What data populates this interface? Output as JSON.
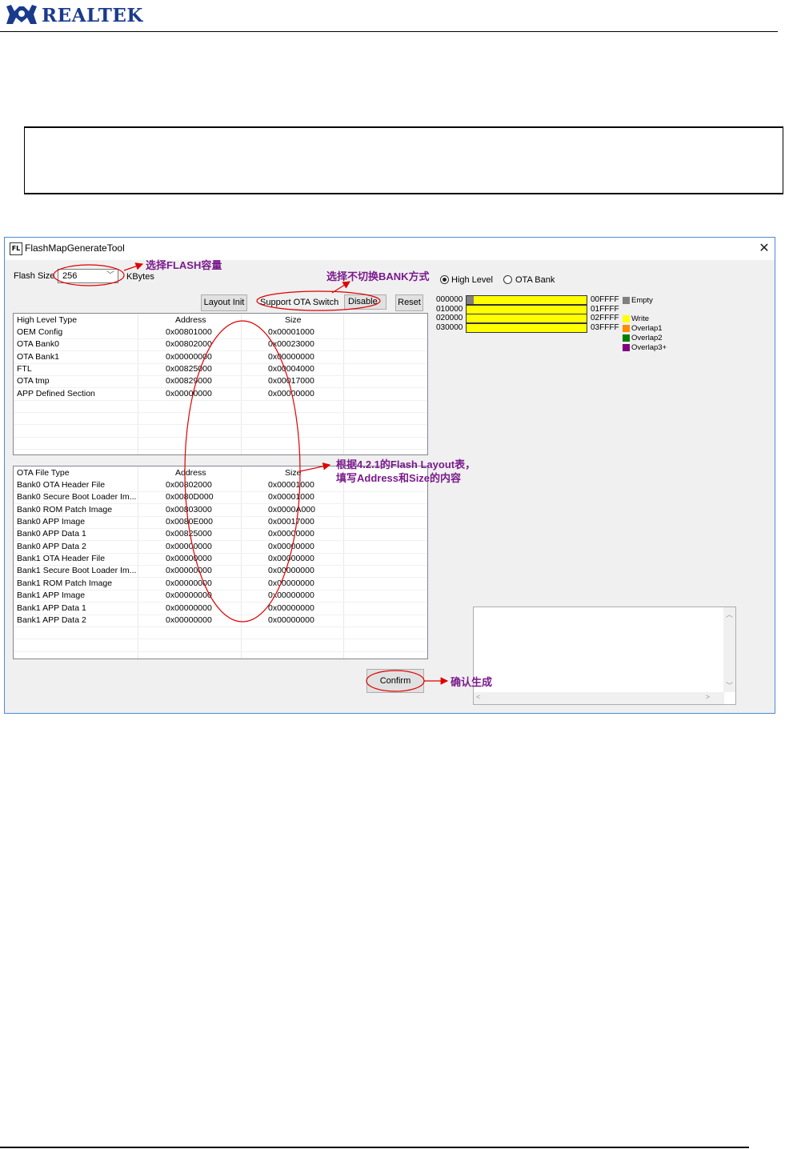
{
  "doc": {
    "brand": "REALTEK"
  },
  "window": {
    "title": "FlashMapGenerateTool",
    "icon_text": "FL",
    "close": "✕"
  },
  "controls": {
    "flash_size_label": "Flash Size",
    "flash_size_value": "256",
    "flash_unit": "KBytes",
    "layout_init": "Layout Init",
    "support_ota_label": "Support OTA Switch",
    "ota_switch_value": "Disable",
    "reset": "Reset",
    "confirm": "Confirm",
    "radio_high_level": "High Level",
    "radio_ota_bank": "OTA Bank",
    "radio_selected": "High Level"
  },
  "high_level_table": {
    "headers": [
      "High Level Type",
      "Address",
      "Size"
    ],
    "rows": [
      [
        "OEM Config",
        "0x00801000",
        "0x00001000"
      ],
      [
        "OTA Bank0",
        "0x00802000",
        "0x00023000"
      ],
      [
        "OTA Bank1",
        "0x00000000",
        "0x00000000"
      ],
      [
        "FTL",
        "0x00825000",
        "0x00004000"
      ],
      [
        "OTA tmp",
        "0x00829000",
        "0x00017000"
      ],
      [
        "APP Defined Section",
        "0x00000000",
        "0x00000000"
      ]
    ]
  },
  "ota_file_table": {
    "headers": [
      "OTA File Type",
      "Address",
      "Size"
    ],
    "rows": [
      [
        "Bank0 OTA Header File",
        "0x00802000",
        "0x00001000"
      ],
      [
        "Bank0 Secure Boot Loader Im...",
        "0x0080D000",
        "0x00001000"
      ],
      [
        "Bank0 ROM Patch Image",
        "0x00803000",
        "0x0000A000"
      ],
      [
        "Bank0 APP Image",
        "0x0080E000",
        "0x00017000"
      ],
      [
        "Bank0 APP Data 1",
        "0x00825000",
        "0x00000000"
      ],
      [
        "Bank0 APP Data 2",
        "0x00000000",
        "0x00000000"
      ],
      [
        "Bank1 OTA Header File",
        "0x00000000",
        "0x00000000"
      ],
      [
        "Bank1 Secure Boot Loader Im...",
        "0x00000000",
        "0x00000000"
      ],
      [
        "Bank1 ROM Patch Image",
        "0x00000000",
        "0x00000000"
      ],
      [
        "Bank1 APP Image",
        "0x00000000",
        "0x00000000"
      ],
      [
        "Bank1 APP Data 1",
        "0x00000000",
        "0x00000000"
      ],
      [
        "Bank1 APP Data 2",
        "0x00000000",
        "0x00000000"
      ]
    ]
  },
  "flash_map": {
    "rows": [
      {
        "start": "000000",
        "end": "00FFFF"
      },
      {
        "start": "010000",
        "end": "01FFFF"
      },
      {
        "start": "020000",
        "end": "02FFFF"
      },
      {
        "start": "030000",
        "end": "03FFFF"
      }
    ],
    "legend": [
      {
        "label": "Empty",
        "color": "#808080"
      },
      {
        "label": "Write",
        "color": "#ffff00"
      },
      {
        "label": "Overlap1",
        "color": "#ff8c00"
      },
      {
        "label": "Overlap2",
        "color": "#008000"
      },
      {
        "label": "Overlap3+",
        "color": "#800080"
      }
    ],
    "write_color": "#ffff00",
    "empty_color": "#808080"
  },
  "annotations": {
    "select_flash": "选择FLASH容量",
    "select_bank": "选择不切换BANK方式",
    "fill_line1": "根据4.2.1的Flash Layout表，",
    "fill_line2": "填写Address和Size的内容",
    "confirm_gen": "确认生成",
    "color": "#cc0000"
  }
}
